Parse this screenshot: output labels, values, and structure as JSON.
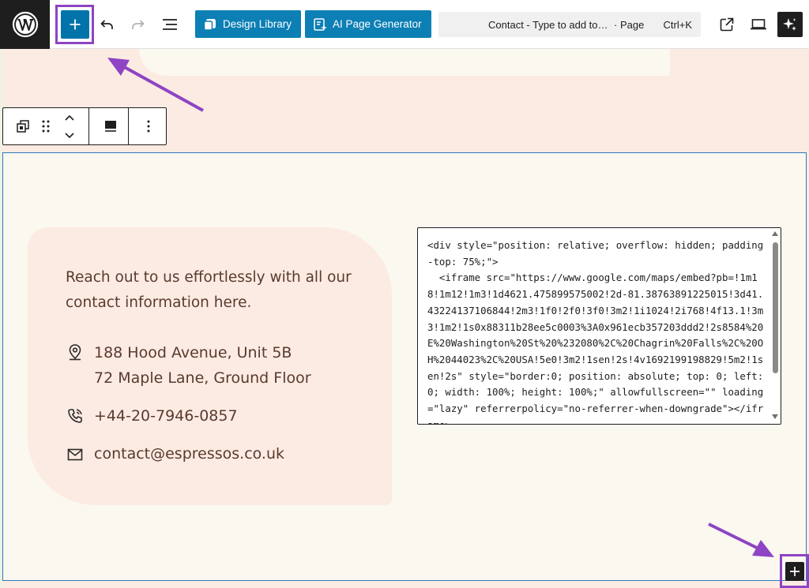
{
  "toolbar": {
    "design_library_label": "Design Library",
    "ai_page_generator_label": "AI Page Generator",
    "command_title": "Contact - Type to add to…",
    "command_kind": "· Page",
    "command_shortcut": "Ctrl+K"
  },
  "contact": {
    "intro": "Reach out to us effortlessly with all our contact information here.",
    "address_line1": "188 Hood Avenue, Unit 5B",
    "address_line2": "72 Maple Lane, Ground Floor",
    "phone": "+44-20-7946-0857",
    "email": "contact@espressos.co.uk"
  },
  "embed_code": "<div style=\"position: relative; overflow: hidden; padding-top: 75%;\">\n  <iframe src=\"https://www.google.com/maps/embed?pb=!1m18!1m12!1m3!1d4621.475899575002!2d-81.38763891225015!3d41.43224137106844!2m3!1f0!2f0!3f0!3m2!1i1024!2i768!4f13.1!3m3!1m2!1s0x88311b28ee5c0003%3A0x961ecb357203ddd2!2s8584%20E%20Washington%20St%20%232080%2C%20Chagrin%20Falls%2C%20OH%2044023%2C%20USA!5e0!3m2!1sen!2s!4v1692199198829!5m2!1sen!2s\" style=\"border:0; position: absolute; top: 0; left: 0; width: 100%; height: 100%;\" allowfullscreen=\"\" loading=\"lazy\" referrerpolicy=\"no-referrer-when-downgrade\"></iframe>\n</div>",
  "icons": {
    "wordpress": "wordpress-logo-icon",
    "inserter": "plus-icon",
    "undo": "undo-icon",
    "redo": "redo-icon",
    "list_view": "list-view-icon",
    "design_library": "design-library-icon",
    "ai_generator": "ai-sparkle-icon",
    "view_page": "external-link-icon",
    "preview": "laptop-preview-icon",
    "ai_assistant": "sparkles-icon",
    "location": "location-pin-icon",
    "phone": "phone-icon",
    "email": "envelope-icon"
  },
  "colors": {
    "primary_button": "#0c7fb4",
    "inserter": "#0073aa",
    "highlight_annotation": "#8e44c4",
    "section_border": "#2b7bbf",
    "card_background": "#fcebe2",
    "section_background": "#fbf8f0",
    "text_brown": "#5a3a2e"
  }
}
